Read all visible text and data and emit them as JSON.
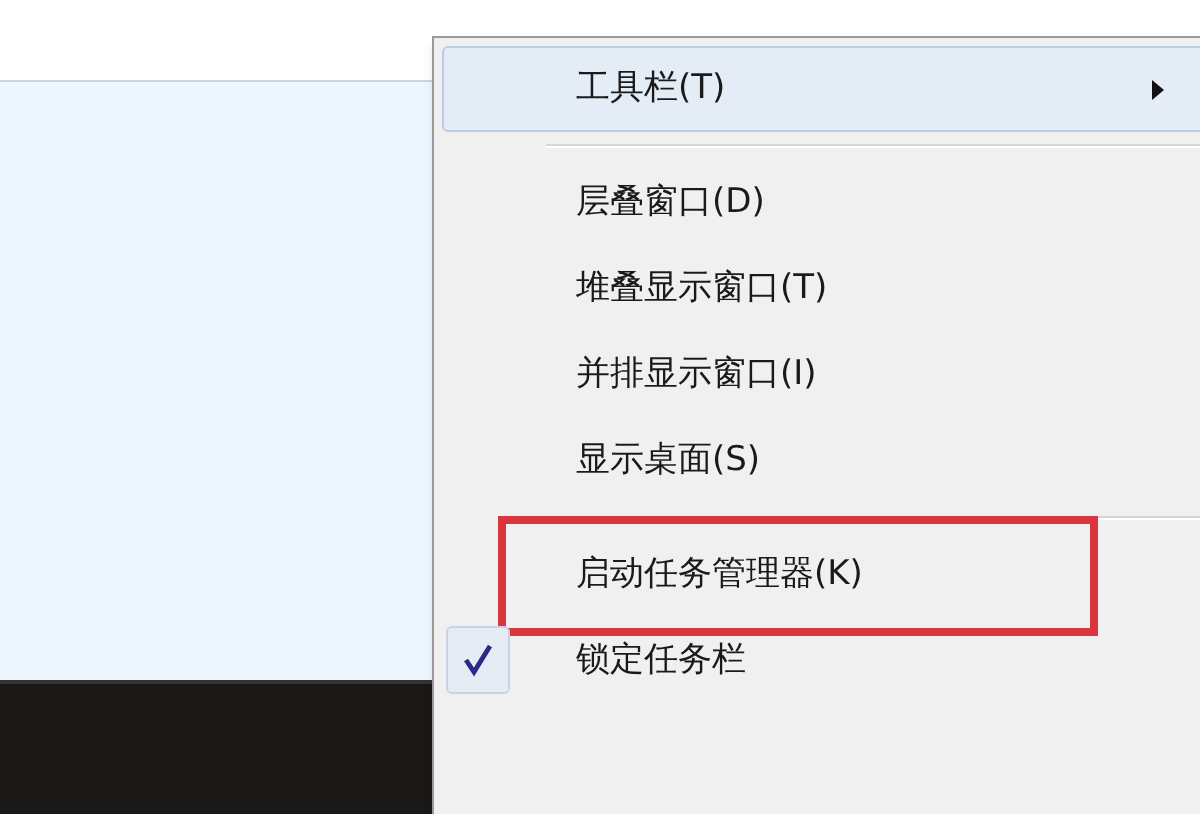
{
  "menu": {
    "items": [
      {
        "kind": "submenu",
        "label": "工具栏(T)",
        "selected": true,
        "checked": false,
        "annotated": false
      },
      {
        "kind": "separator"
      },
      {
        "kind": "item",
        "label": "层叠窗口(D)",
        "selected": false,
        "checked": false,
        "annotated": false
      },
      {
        "kind": "item",
        "label": "堆叠显示窗口(T)",
        "selected": false,
        "checked": false,
        "annotated": false
      },
      {
        "kind": "item",
        "label": "并排显示窗口(I)",
        "selected": false,
        "checked": false,
        "annotated": false
      },
      {
        "kind": "item",
        "label": "显示桌面(S)",
        "selected": false,
        "checked": false,
        "annotated": false
      },
      {
        "kind": "separator"
      },
      {
        "kind": "item",
        "label": "启动任务管理器(K)",
        "selected": false,
        "checked": false,
        "annotated": true
      },
      {
        "kind": "item",
        "label": "锁定任务栏",
        "selected": false,
        "checked": true,
        "annotated": false
      }
    ]
  }
}
